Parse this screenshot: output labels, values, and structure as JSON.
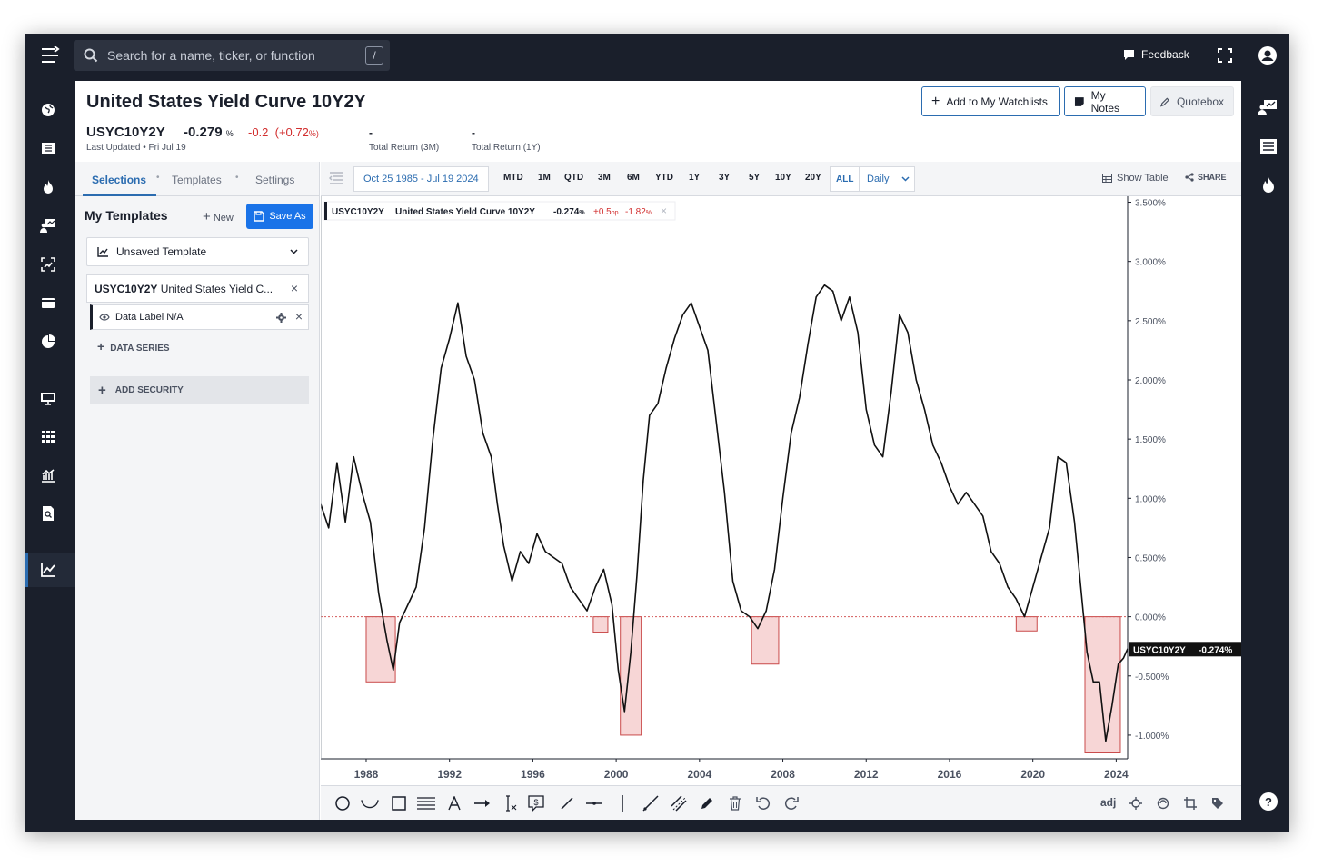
{
  "search": {
    "placeholder": "Search for a name, ticker, or function",
    "shortcut": "/"
  },
  "topbar": {
    "feedback_label": "Feedback"
  },
  "header": {
    "title": "United States Yield Curve 10Y2Y",
    "symbol": "USYC10Y2Y",
    "last_value": "-0.279",
    "last_unit": "%",
    "change": "-0.2",
    "change_pct": "(+0.72",
    "change_pct_unit": "%)",
    "last_updated": "Last Updated • Fri Jul 19",
    "total_return_3m_value": "-",
    "total_return_3m_label": "Total Return (3M)",
    "total_return_1y_value": "-",
    "total_return_1y_label": "Total Return (1Y)",
    "buttons": {
      "watchlist": "Add to My Watchlists",
      "notes": "My Notes",
      "quotebox": "Quotebox"
    }
  },
  "left_panel": {
    "tabs": [
      "Selections",
      "Templates",
      "Settings"
    ],
    "my_templates": "My Templates",
    "new_label": "New",
    "save_as_label": "Save As",
    "template_select": "Unsaved Template",
    "security_symbol": "USYC10Y2Y",
    "security_name": "United States Yield C...",
    "data_label": "Data Label N/A",
    "data_series": "DATA SERIES",
    "add_security": "ADD SECURITY"
  },
  "toolbar": {
    "date_range": "Oct 25 1985 - Jul 19 2024",
    "timeframes": [
      "MTD",
      "1M",
      "QTD",
      "3M",
      "6M",
      "YTD",
      "1Y",
      "3Y",
      "5Y",
      "10Y",
      "20Y",
      "ALL"
    ],
    "selected_timeframe": "ALL",
    "interval": "Daily",
    "show_table": "Show Table",
    "share": "SHARE"
  },
  "legend": {
    "symbol": "USYC10Y2Y",
    "name": "United States Yield Curve 10Y2Y",
    "value": "-0.274",
    "unit": "%",
    "change": "+0.5",
    "change_unit": "bp",
    "change_pct": "-1.82",
    "change_pct_unit": "%"
  },
  "price_tag": {
    "symbol": "USYC10Y2Y",
    "value": "-0.274%"
  },
  "drawing_tools": [
    "circle",
    "arc",
    "rectangle",
    "lines",
    "text",
    "arrow",
    "text-cursor",
    "callout",
    "line",
    "horizontal-line",
    "vertical-line",
    "ray",
    "parallel-channel",
    "pencil",
    "trash",
    "undo",
    "redo"
  ],
  "chart_options": {
    "adj_label": "adj"
  },
  "chart_data": {
    "type": "line",
    "title": "",
    "xlabel": "",
    "ylabel": "",
    "x_ticks": [
      "1988",
      "1992",
      "1996",
      "2000",
      "2004",
      "2008",
      "2012",
      "2016",
      "2020",
      "2024"
    ],
    "y_ticks": [
      "3.500%",
      "3.000%",
      "2.500%",
      "2.000%",
      "1.500%",
      "1.000%",
      "0.500%",
      "0.000%",
      "-0.500%",
      "-1.000%"
    ],
    "ylim": [
      -1.2,
      3.55
    ],
    "xlim": [
      1985.82,
      2024.55
    ],
    "grid": false,
    "zero_line": 0,
    "series": [
      {
        "name": "USYC10Y2Y",
        "color": "#111111",
        "x": [
          1985.82,
          1986.2,
          1986.6,
          1987.0,
          1987.4,
          1987.8,
          1988.2,
          1988.6,
          1989.0,
          1989.3,
          1989.6,
          1990.0,
          1990.4,
          1990.8,
          1991.2,
          1991.6,
          1992.0,
          1992.4,
          1992.8,
          1993.2,
          1993.6,
          1994.0,
          1994.3,
          1994.6,
          1995.0,
          1995.4,
          1995.8,
          1996.2,
          1996.6,
          1997.0,
          1997.4,
          1997.8,
          1998.2,
          1998.6,
          1999.0,
          1999.4,
          1999.8,
          2000.1,
          2000.4,
          2000.7,
          2001.0,
          2001.3,
          2001.6,
          2002.0,
          2002.4,
          2002.8,
          2003.2,
          2003.6,
          2004.0,
          2004.4,
          2004.8,
          2005.2,
          2005.6,
          2006.0,
          2006.4,
          2006.8,
          2007.2,
          2007.6,
          2008.0,
          2008.4,
          2008.8,
          2009.2,
          2009.6,
          2010.0,
          2010.4,
          2010.8,
          2011.2,
          2011.6,
          2012.0,
          2012.4,
          2012.8,
          2013.2,
          2013.6,
          2014.0,
          2014.4,
          2014.8,
          2015.2,
          2015.6,
          2016.0,
          2016.4,
          2016.8,
          2017.2,
          2017.6,
          2018.0,
          2018.4,
          2018.8,
          2019.2,
          2019.6,
          2020.0,
          2020.4,
          2020.8,
          2021.2,
          2021.6,
          2022.0,
          2022.3,
          2022.6,
          2022.9,
          2023.2,
          2023.5,
          2023.8,
          2024.1,
          2024.35,
          2024.55
        ],
        "values": [
          0.95,
          0.75,
          1.3,
          0.8,
          1.35,
          1.05,
          0.8,
          0.2,
          -0.2,
          -0.45,
          -0.05,
          0.1,
          0.25,
          0.75,
          1.5,
          2.1,
          2.35,
          2.65,
          2.2,
          2.0,
          1.55,
          1.35,
          0.95,
          0.6,
          0.3,
          0.55,
          0.45,
          0.7,
          0.55,
          0.5,
          0.45,
          0.25,
          0.15,
          0.05,
          0.25,
          0.4,
          0.1,
          -0.45,
          -0.8,
          -0.3,
          0.35,
          1.15,
          1.7,
          1.8,
          2.1,
          2.35,
          2.55,
          2.65,
          2.45,
          2.25,
          1.65,
          1.05,
          0.3,
          0.05,
          0.0,
          -0.1,
          0.05,
          0.4,
          1.0,
          1.55,
          1.85,
          2.3,
          2.7,
          2.8,
          2.75,
          2.5,
          2.7,
          2.4,
          1.75,
          1.45,
          1.35,
          1.9,
          2.55,
          2.4,
          2.0,
          1.75,
          1.45,
          1.3,
          1.1,
          0.95,
          1.05,
          0.95,
          0.85,
          0.55,
          0.45,
          0.25,
          0.15,
          0.0,
          0.25,
          0.5,
          0.75,
          1.35,
          1.3,
          0.8,
          0.25,
          -0.3,
          -0.55,
          -0.55,
          -1.05,
          -0.75,
          -0.4,
          -0.35,
          -0.27
        ]
      }
    ],
    "highlight_boxes": [
      {
        "x0": 1988.0,
        "x1": 1989.4,
        "y0": -0.55,
        "y1": 0.0
      },
      {
        "x0": 1998.9,
        "x1": 1999.6,
        "y0": -0.13,
        "y1": 0.0
      },
      {
        "x0": 2000.2,
        "x1": 2001.2,
        "y0": -1.0,
        "y1": 0.0
      },
      {
        "x0": 2006.5,
        "x1": 2007.8,
        "y0": -0.4,
        "y1": 0.0
      },
      {
        "x0": 2019.2,
        "x1": 2020.2,
        "y0": -0.12,
        "y1": 0.0
      },
      {
        "x0": 2022.5,
        "x1": 2024.2,
        "y0": -1.15,
        "y1": 0.0
      }
    ],
    "last_value": -0.274
  }
}
